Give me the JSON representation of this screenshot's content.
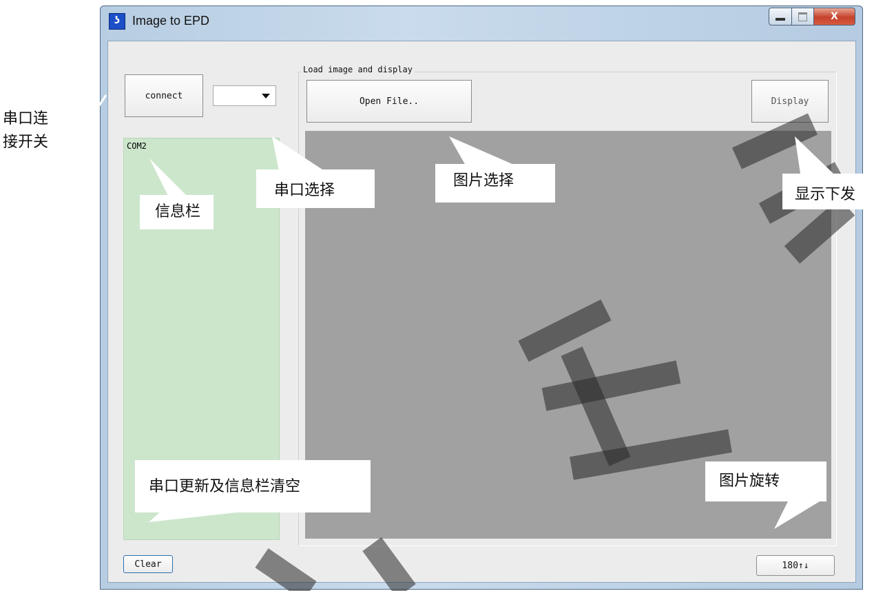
{
  "window": {
    "title": "Image to EPD",
    "close_glyph": "X"
  },
  "toolbar": {
    "connect_label": "connect",
    "port_value": "",
    "open_file_label": "Open File..",
    "display_label": "Display",
    "clear_label": "Clear",
    "rotate_label": "180↑↓"
  },
  "group": {
    "label": "Load image and display"
  },
  "info_panel": {
    "text": "COM2"
  },
  "annotations": {
    "connect_switch": "串口连\n接开关",
    "port_select": "串口选择",
    "info_bar": "信息栏",
    "image_select": "图片选择",
    "display_send": "显示下发",
    "refresh_clear": "串口更新及信息栏清空",
    "image_rotate": "图片旋转"
  },
  "watermark": {
    "text": "佳"
  },
  "icons": {
    "app": "app-logo-icon",
    "dropdown": "chevron-down-icon"
  }
}
